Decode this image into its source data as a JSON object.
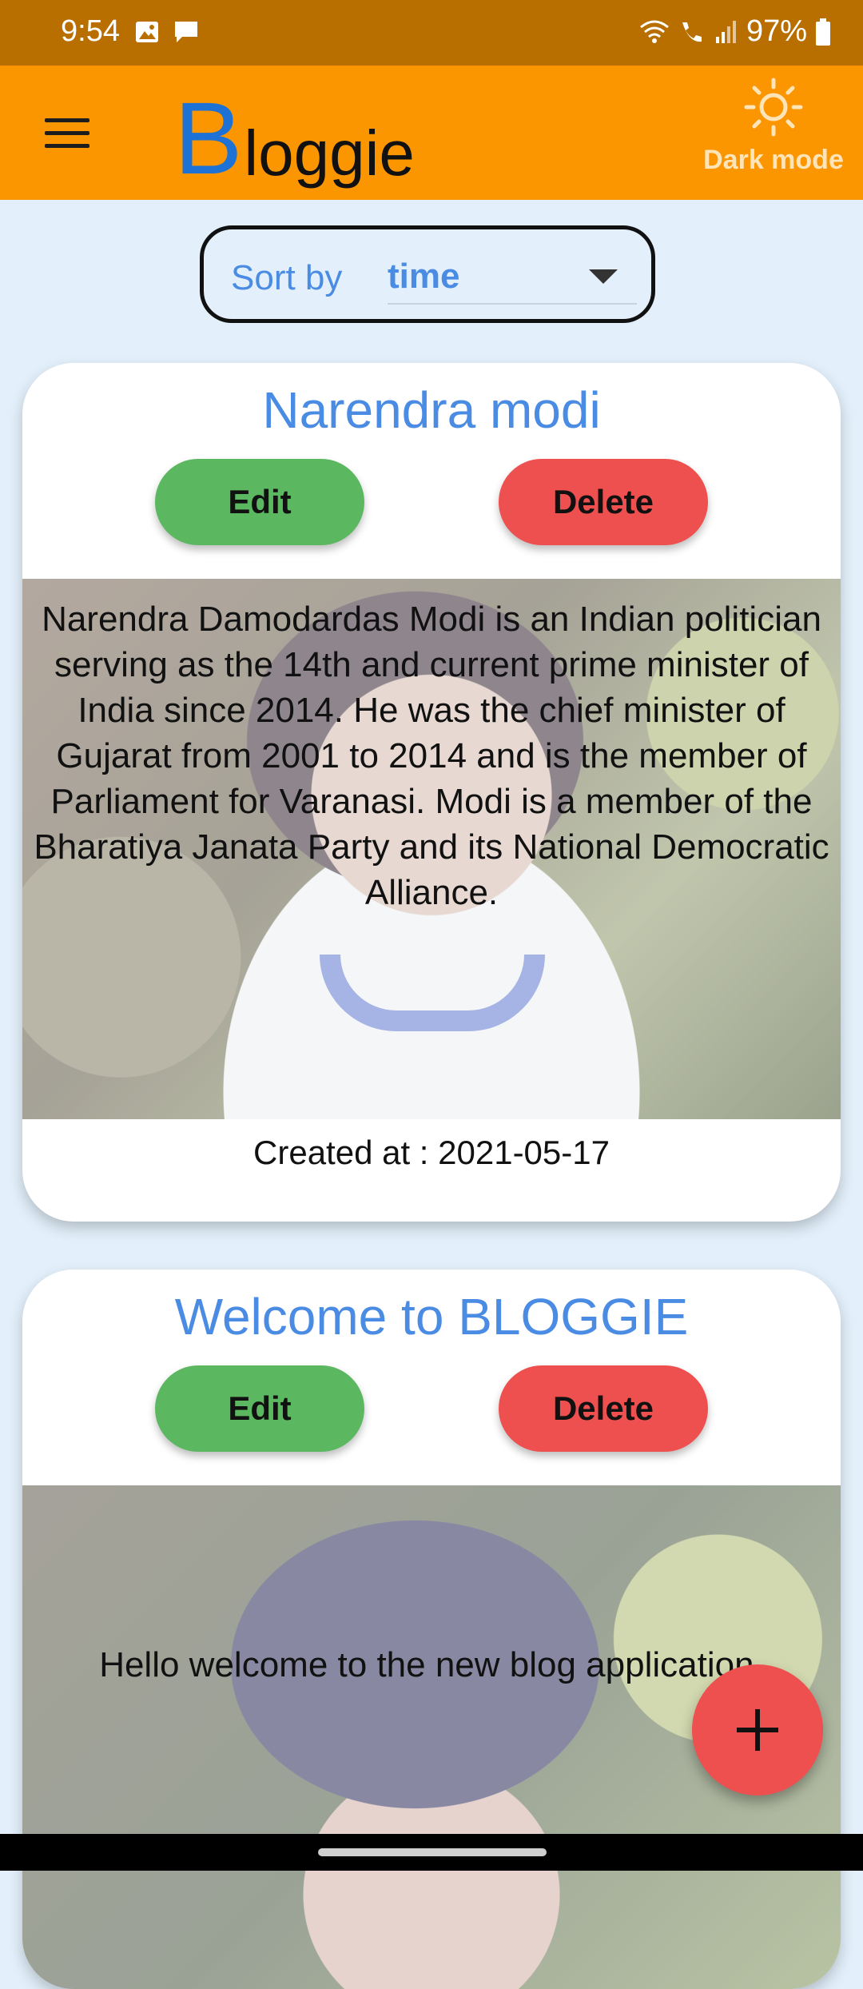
{
  "status_bar": {
    "time": "9:54",
    "battery": "97%",
    "icons": [
      "image-icon",
      "message-icon",
      "wifi-icon",
      "call-icon",
      "signal-icon",
      "battery-icon"
    ]
  },
  "app_bar": {
    "logo_initial": "B",
    "logo_rest": "loggie",
    "dark_mode_label": "Dark mode",
    "colors": {
      "bar": "#fb9500",
      "logo_b": "#1e72d6"
    }
  },
  "sort": {
    "label": "Sort by",
    "selected": "time"
  },
  "posts": [
    {
      "title": "Narendra modi",
      "edit_label": "Edit",
      "delete_label": "Delete",
      "body": "Narendra Damodardas Modi is an Indian politician serving as the 14th and current prime minister of India since 2014. He was the chief minister of Gujarat from 2001 to 2014 and is the member of Parliament for Varanasi. Modi is a member of the Bharatiya Janata Party and its National Democratic Alliance.",
      "created_at": "Created at : 2021-05-17"
    },
    {
      "title": "Welcome to BLOGGIE",
      "edit_label": "Edit",
      "delete_label": "Delete",
      "body": "Hello welcome to the new blog application."
    }
  ],
  "fab": {
    "icon": "plus-icon",
    "color": "#ee4f4f"
  }
}
